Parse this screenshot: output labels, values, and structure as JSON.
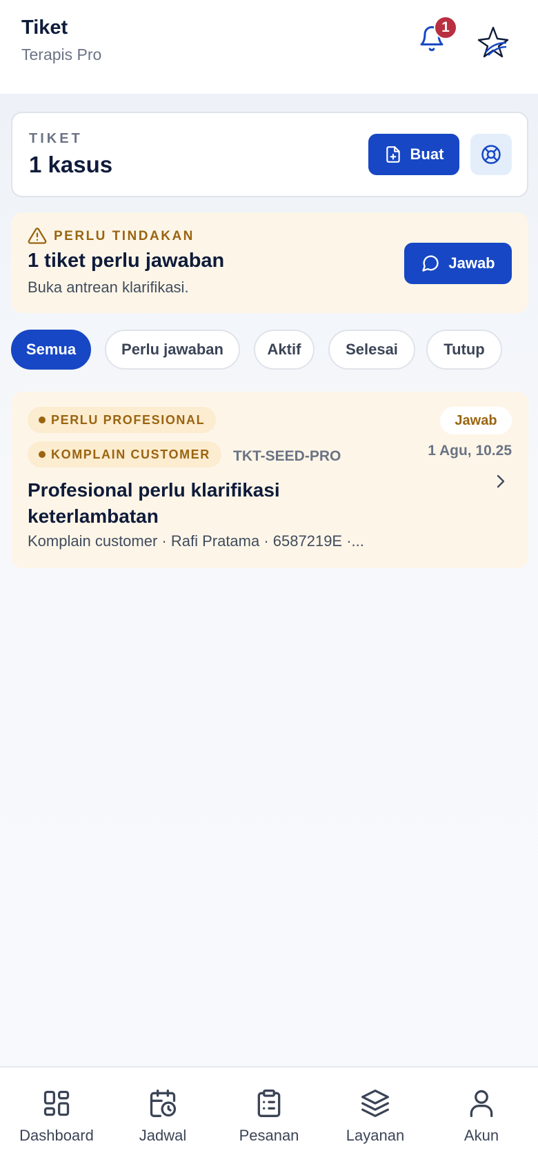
{
  "header": {
    "title": "Tiket",
    "subtitle": "Terapis Pro",
    "notification_count": "1"
  },
  "summary": {
    "label": "TIKET",
    "count": "1 kasus",
    "create_label": "Buat"
  },
  "action": {
    "label": "PERLU TINDAKAN",
    "title": "1 tiket perlu jawaban",
    "subtitle": "Buka antrean klarifikasi.",
    "button_label": "Jawab"
  },
  "filters": [
    {
      "label": "Semua",
      "active": true
    },
    {
      "label": "Perlu jawaban",
      "active": false
    },
    {
      "label": "Aktif",
      "active": false
    },
    {
      "label": "Selesai",
      "active": false
    },
    {
      "label": "Tutup",
      "active": false
    }
  ],
  "tickets": [
    {
      "tag_primary": "PERLU PROFESIONAL",
      "tag_secondary": "KOMPLAIN CUSTOMER",
      "code": "TKT-SEED-PRO",
      "status": "Jawab",
      "date": "1 Agu, 10.25",
      "title": "Profesional perlu klarifikasi keterlambatan",
      "meta": "Komplain customer · Rafi Pratama · 6587219E ·..."
    }
  ],
  "nav": [
    {
      "label": "Dashboard",
      "icon": "dashboard-icon"
    },
    {
      "label": "Jadwal",
      "icon": "calendar-clock-icon"
    },
    {
      "label": "Pesanan",
      "icon": "clipboard-list-icon"
    },
    {
      "label": "Layanan",
      "icon": "layers-icon"
    },
    {
      "label": "Akun",
      "icon": "user-icon"
    }
  ],
  "colors": {
    "primary": "#1747c4",
    "warning_text": "#9a6410",
    "warning_bg": "#fdf6e8",
    "badge": "#b83040"
  }
}
